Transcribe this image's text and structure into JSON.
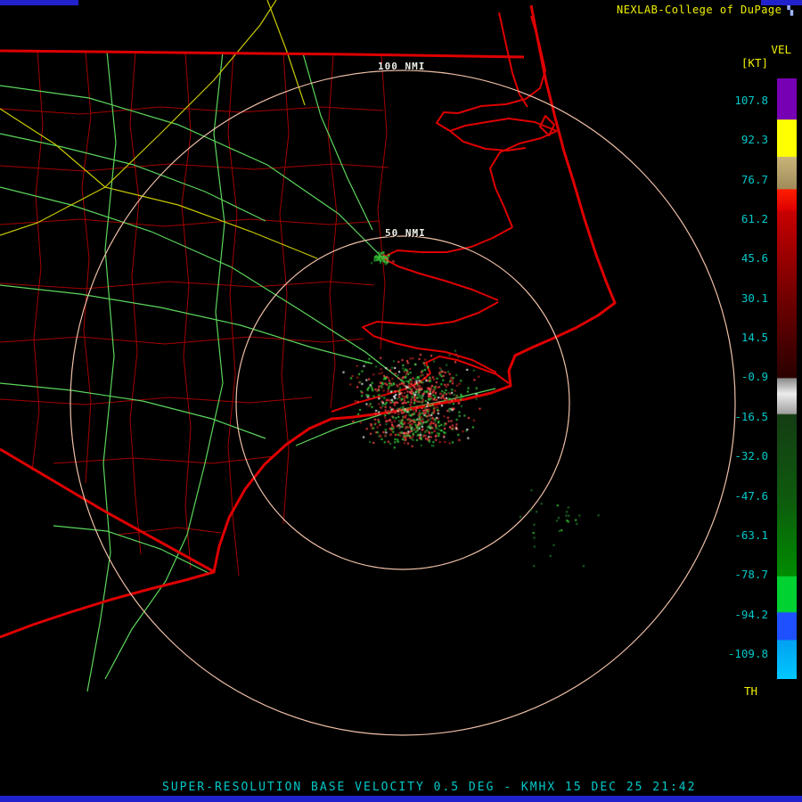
{
  "header": {
    "title": "NEXLAB-College of DuPage",
    "icon_glyph": "▚"
  },
  "colorbar": {
    "label": "VEL",
    "unit": "[KT]",
    "ticks": [
      "107.8",
      "92.3",
      "76.7",
      "61.2",
      "45.6",
      "30.1",
      "14.5",
      "-0.9",
      "-16.5",
      "-32.0",
      "-47.6",
      "-63.1",
      "-78.7",
      "-94.2",
      "-109.8"
    ],
    "threshold_label": "TH",
    "stops": [
      [
        0,
        "#7800B4"
      ],
      [
        6.8,
        "#7800B4"
      ],
      [
        6.9,
        "#FFFF00"
      ],
      [
        13,
        "#FFFF00"
      ],
      [
        13.1,
        "#C8B478"
      ],
      [
        18.4,
        "#A08C5A"
      ],
      [
        18.5,
        "#FF1E00"
      ],
      [
        22,
        "#DC0000"
      ],
      [
        22.1,
        "#C80000"
      ],
      [
        35,
        "#7A0000"
      ],
      [
        49.8,
        "#2A0000"
      ],
      [
        50,
        "#8C8C8C"
      ],
      [
        52.5,
        "#ECECEC"
      ],
      [
        55.8,
        "#A0A0A0"
      ],
      [
        56,
        "#143C14"
      ],
      [
        70,
        "#0E5A0E"
      ],
      [
        82.8,
        "#008C00"
      ],
      [
        83,
        "#00D232"
      ],
      [
        88.8,
        "#00D232"
      ],
      [
        89,
        "#1E50FF"
      ],
      [
        93.4,
        "#1E50FF"
      ],
      [
        93.6,
        "#00A0F0"
      ],
      [
        100,
        "#00C8FF"
      ]
    ]
  },
  "map": {
    "radar_site": "KMHX",
    "rings": [
      {
        "label": "100 NMI"
      },
      {
        "label": "50 NMI"
      }
    ]
  },
  "footer": {
    "text": "SUPER-RESOLUTION BASE VELOCITY 0.5 DEG - KMHX 15 DEC 25 21:42"
  },
  "colors": {
    "annotation": "#00C8C8",
    "title": "#F0F000",
    "ring": "#F0C0A8",
    "coast": "#DE0000",
    "county": "#A40000",
    "road_green": "#5CD65C",
    "road_yellow": "#C8C800",
    "frame_blue": "#2222CC",
    "speckle_palette": {
      "red": "#FF4848",
      "dark_red": "#B02020",
      "green": "#38C838",
      "dark_green": "#1E7828",
      "white": "#E8E8E8"
    }
  }
}
